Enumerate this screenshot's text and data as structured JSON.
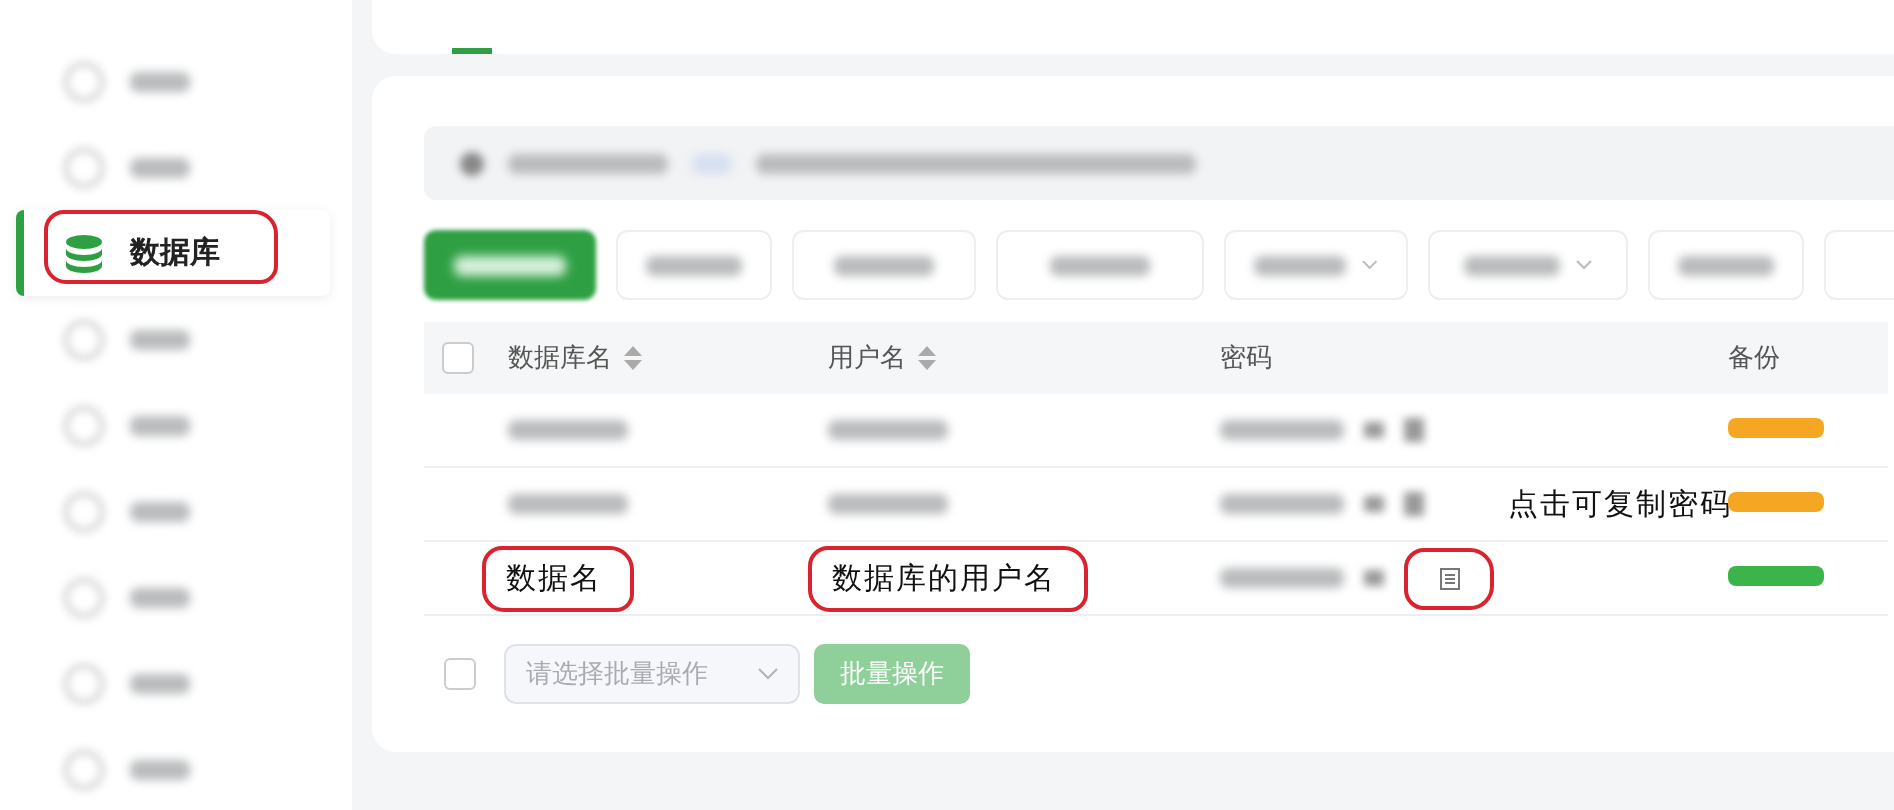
{
  "sidebar": {
    "items": [
      {
        "kind": "blurred",
        "selected": false,
        "circled": false
      },
      {
        "kind": "blurred",
        "selected": false,
        "circled": false
      },
      {
        "kind": "item",
        "label": "数据库",
        "selected": true,
        "circled": true
      },
      {
        "kind": "blurred",
        "selected": false,
        "circled": false
      },
      {
        "kind": "blurred",
        "selected": false,
        "circled": false
      },
      {
        "kind": "blurred",
        "selected": false,
        "circled": false
      },
      {
        "kind": "blurred",
        "selected": false,
        "circled": false
      },
      {
        "kind": "blurred",
        "selected": false,
        "circled": false
      },
      {
        "kind": "blurred",
        "selected": false,
        "circled": false
      }
    ]
  },
  "top_bar": {
    "underline": true
  },
  "toolbar": [
    {
      "kind": "primary"
    },
    {
      "kind": "plain"
    },
    {
      "kind": "plain"
    },
    {
      "kind": "plain"
    },
    {
      "kind": "dropdown"
    },
    {
      "kind": "dropdown"
    },
    {
      "kind": "plain"
    },
    {
      "kind": "edge"
    }
  ],
  "table": {
    "select_all": {
      "checked": false
    },
    "columns": [
      {
        "label": "数据库名",
        "sortable": true
      },
      {
        "label": "用户名",
        "sortable": true
      },
      {
        "label": "密码",
        "sortable": false
      },
      {
        "label": "备份",
        "sortable": false
      }
    ],
    "rows": [
      {
        "backup": {
          "color": "#f5a623"
        },
        "copy_blurred": true,
        "copy_circled": false
      },
      {
        "backup": {
          "color": "#f5a623"
        },
        "copy_blurred": true,
        "copy_circled": false,
        "note": "点击可复制密码"
      },
      {
        "backup": {
          "color": "#3bb54a"
        },
        "copy_blurred": false,
        "name_note": "数据名",
        "user_note": "数据库的用户名",
        "copy_circled": true
      }
    ]
  },
  "footer": {
    "checked": false,
    "placeholder": "请选择批量操作",
    "button": "批量操作",
    "disabled": true
  }
}
